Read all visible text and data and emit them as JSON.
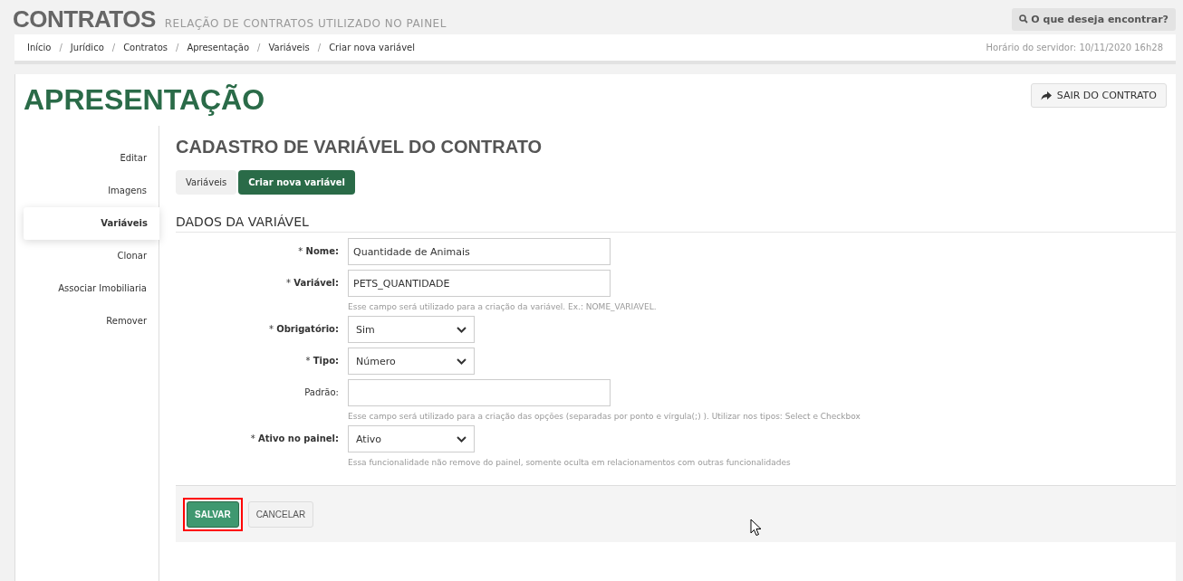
{
  "header": {
    "title": "CONTRATOS",
    "subtitle": "RELAÇÃO DE CONTRATOS UTILIZADO NO PAINEL",
    "search_button": "O que deseja encontrar?"
  },
  "breadcrumb": {
    "items": [
      "Início",
      "Jurídico",
      "Contratos",
      "Apresentação",
      "Variáveis",
      "Criar nova variável"
    ],
    "separator": "/",
    "server_time": "Horário do servidor: 10/11/2020 16h28"
  },
  "page": {
    "title": "APRESENTAÇÃO",
    "exit_button": "SAIR DO CONTRATO"
  },
  "sidebar": {
    "items": [
      {
        "label": "Editar",
        "selected": false
      },
      {
        "label": "Imagens",
        "selected": false
      },
      {
        "label": "Variáveis",
        "selected": true
      },
      {
        "label": "Clonar",
        "selected": false
      },
      {
        "label": "Associar Imobiliaria",
        "selected": false
      },
      {
        "label": "Remover",
        "selected": false
      }
    ]
  },
  "form": {
    "title": "CADASTRO DE VARIÁVEL DO CONTRATO",
    "tabs": [
      {
        "label": "Variáveis",
        "selected": false
      },
      {
        "label": "Criar nova variável",
        "selected": true
      }
    ],
    "section_title": "DADOS DA VARIÁVEL",
    "fields": [
      {
        "kind": "text",
        "label": "* **Nome:**",
        "value": "Quantidade de Animais"
      },
      {
        "kind": "text",
        "label": "* **Variável:**",
        "value": "PETS_QUANTIDADE",
        "help": "Esse campo será utilizado para a criação da variável. Ex.: NOME_VARIAVEL."
      },
      {
        "kind": "select",
        "label": "* **Obrigatório:**",
        "value": "Sim"
      },
      {
        "kind": "select",
        "label": "* **Tipo:**",
        "value": "Número"
      },
      {
        "kind": "text",
        "label": "Padrão:",
        "help": "Esse campo será utilizado para a criação das opções (separadas por ponto e vírgula(;) ). Utilizar nos tipos: Select e Checkbox"
      },
      {
        "kind": "select",
        "label": "* **Ativo no painel:**",
        "value": "Ativo",
        "help": "Essa funcionalidade não remove do painel, somente oculta em relacionamentos com outras funcionalidades"
      }
    ],
    "buttons": [
      {
        "kind": "primary",
        "label": "SALVAR",
        "highlighted": true
      },
      {
        "kind": "secondary",
        "label": "CANCELAR",
        "highlighted": false
      }
    ]
  }
}
